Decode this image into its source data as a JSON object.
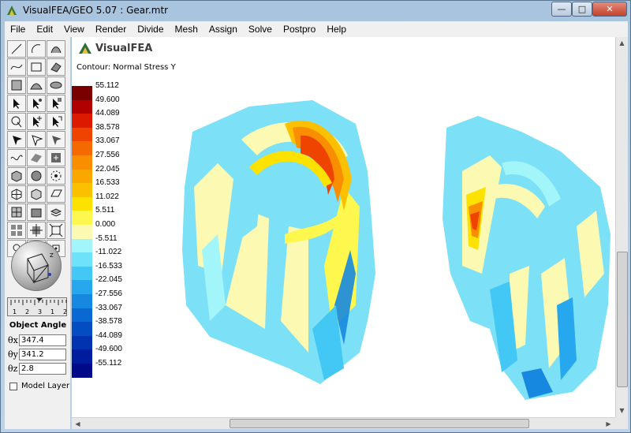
{
  "window": {
    "title": "VisualFEA/GEO 5.07 :  Gear.mtr",
    "buttons": {
      "minimize": "—",
      "maximize": "□",
      "close": "✕"
    }
  },
  "menu": [
    "File",
    "Edit",
    "View",
    "Render",
    "Divide",
    "Mesh",
    "Assign",
    "Solve",
    "Postpro",
    "Help"
  ],
  "brand": {
    "name": "VisualFEA"
  },
  "contour": {
    "title": "Contour: Normal Stress Y",
    "labels": [
      "55.112",
      "49.600",
      "44.089",
      "38.578",
      "33.067",
      "27.556",
      "22.045",
      "16.533",
      "11.022",
      "5.511",
      "0.000",
      "-5.511",
      "-11.022",
      "-16.533",
      "-22.045",
      "-27.556",
      "-33.067",
      "-38.578",
      "-44.089",
      "-49.600",
      "-55.112"
    ],
    "colors": [
      "#7a0000",
      "#b00000",
      "#dd1a00",
      "#ee4400",
      "#f56a00",
      "#f88e00",
      "#faa800",
      "#fbc100",
      "#fde200",
      "#fdf74e",
      "#fcf9b3",
      "#a2f5f8",
      "#6ee2f8",
      "#43c7f5",
      "#27a8ee",
      "#1688e0",
      "#0a68d2",
      "#044cc2",
      "#0033b0",
      "#001c9e",
      "#000a88"
    ]
  },
  "object_angle": {
    "title": "Object Angle",
    "theta_x_label": "θx",
    "theta_y_label": "θy",
    "theta_z_label": "θz",
    "theta_x": "347.4",
    "theta_y": "341.2",
    "theta_z": "2.8"
  },
  "model_layer": {
    "label": "Model Layer",
    "checked": false
  },
  "scale_dial": {
    "labels": [
      "1",
      "2",
      "3",
      "1",
      "2"
    ]
  },
  "toolbar_icons": [
    "line-icon",
    "arc-icon",
    "curve-surface-icon",
    "spline-icon",
    "rectangle-icon",
    "surface-icon",
    "mesh-icon",
    "dome-icon",
    "disc-icon",
    "select-arrow-icon",
    "select-node-icon",
    "select-face-icon",
    "select-circle-icon",
    "select-add-icon",
    "select-region-icon",
    "pick-icon",
    "pick-arrow-icon",
    "pick-solid-icon",
    "wave-icon",
    "sheet-icon",
    "zoom-fit-icon",
    "render-cube-icon",
    "render-sphere-icon",
    "render-gear-icon",
    "grid-cube-icon",
    "cube-icon",
    "plane-icon",
    "split-icon",
    "block-icon",
    "layer-icon",
    "multi-block-icon",
    "move-block-icon",
    "expand-block-icon",
    "target-icon",
    "pan-icon",
    "point-icon"
  ]
}
